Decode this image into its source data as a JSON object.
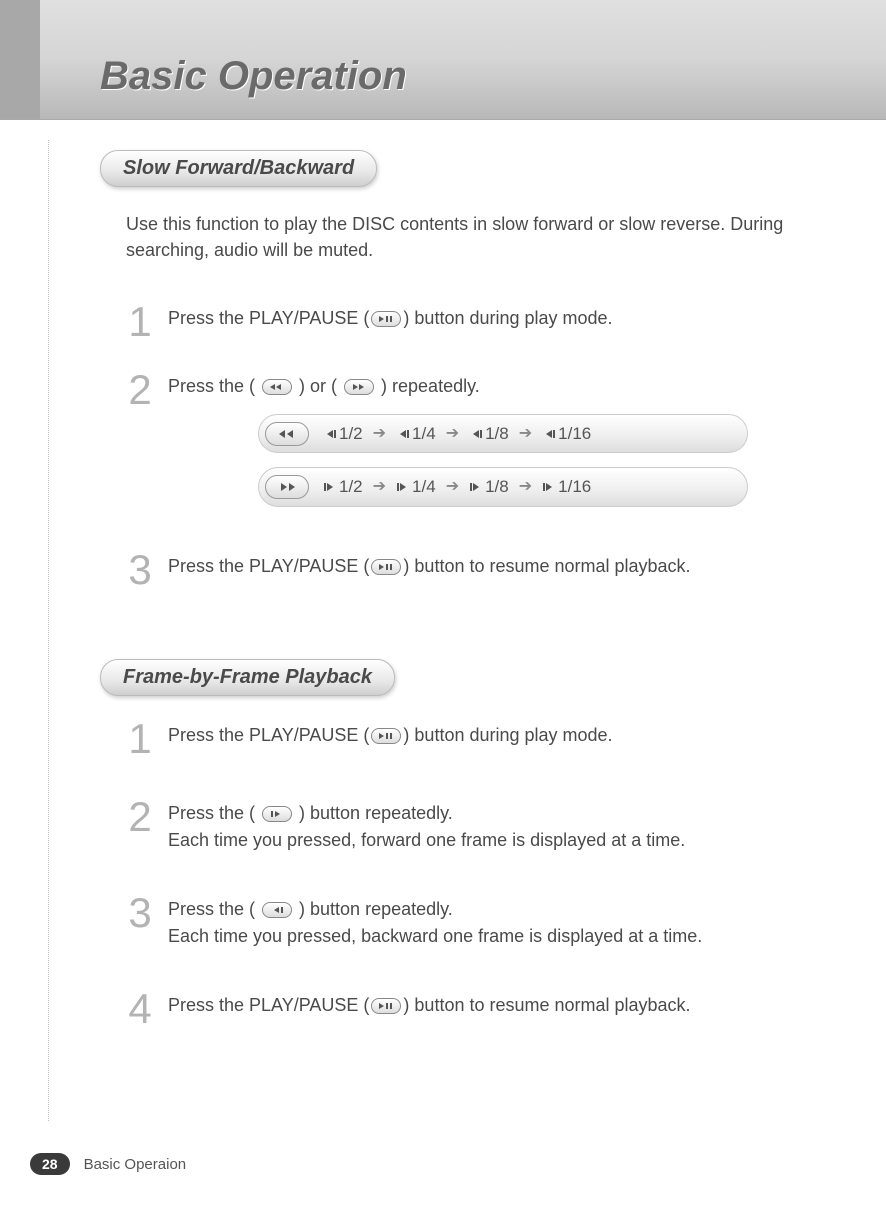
{
  "page_title": "Basic Operation",
  "section1": {
    "heading": "Slow Forward/Backward",
    "intro": "Use this function to play the DISC contents in slow forward or slow reverse. During searching, audio will be muted.",
    "steps": {
      "s1_pre": "Press the PLAY/PAUSE (",
      "s1_post": ") button during play mode.",
      "s2_pre": "Press the ( ",
      "s2_mid": " ) or ( ",
      "s2_post": " ) repeatedly.",
      "s3_pre": "Press the PLAY/PAUSE (",
      "s3_post": ") button to resume normal playback."
    },
    "rev_speeds": [
      "1/2",
      "1/4",
      "1/8",
      "1/16"
    ],
    "fwd_speeds": [
      "1/2",
      "1/4",
      "1/8",
      "1/16"
    ]
  },
  "section2": {
    "heading": "Frame-by-Frame Playback",
    "steps": {
      "s1_pre": "Press the PLAY/PAUSE (",
      "s1_post": ") button during play mode.",
      "s2_pre": "Press the ( ",
      "s2_mid": " ) button repeatedly.",
      "s2_line2": "Each time you pressed, forward one frame is displayed at a time.",
      "s3_pre": "Press the ( ",
      "s3_mid": " ) button repeatedly.",
      "s3_line2": "Each time you pressed, backward one frame is displayed at a time.",
      "s4_pre": "Press the PLAY/PAUSE (",
      "s4_post": ") button to resume normal playback."
    }
  },
  "footer": {
    "page_number": "28",
    "label": "Basic Operaion"
  },
  "nums": {
    "n1": "1",
    "n2": "2",
    "n3": "3",
    "n4": "4"
  }
}
